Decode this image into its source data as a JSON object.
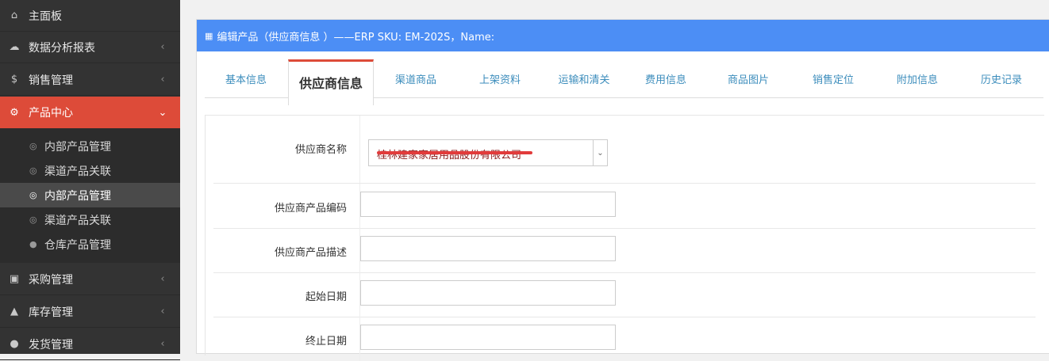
{
  "sidebar": {
    "items": [
      {
        "label": "主面板",
        "icon": "home-icon"
      },
      {
        "label": "数据分析报表",
        "icon": "cloud-icon"
      },
      {
        "label": "销售管理",
        "icon": "dollar-icon"
      },
      {
        "label": "产品中心",
        "icon": "cogs-icon"
      },
      {
        "label": "采购管理",
        "icon": "cube-icon"
      },
      {
        "label": "库存管理",
        "icon": "android-icon"
      },
      {
        "label": "发货管理",
        "icon": "circle-icon"
      }
    ],
    "sub_items": [
      {
        "label": "内部产品管理"
      },
      {
        "label": "渠道产品关联"
      },
      {
        "label": "内部产品管理"
      },
      {
        "label": "渠道产品关联"
      },
      {
        "label": "仓库产品管理"
      }
    ]
  },
  "panel": {
    "title": "编辑产品（供应商信息 ）——ERP SKU: EM-202S，Name:",
    "title_icon": "gift-icon"
  },
  "tabs": [
    {
      "label": "基本信息"
    },
    {
      "label": "供应商信息"
    },
    {
      "label": "渠道商品"
    },
    {
      "label": "上架资料"
    },
    {
      "label": "运输和清关"
    },
    {
      "label": "费用信息"
    },
    {
      "label": "商品图片"
    },
    {
      "label": "销售定位"
    },
    {
      "label": "附加信息"
    },
    {
      "label": "历史记录"
    }
  ],
  "form": {
    "supplier_name_label": "供应商名称",
    "supplier_name_value": "桂林建家家居用品股份有限公司",
    "supplier_code_label": "供应商产品编码",
    "supplier_code_value": "",
    "supplier_desc_label": "供应商产品描述",
    "supplier_desc_value": "",
    "start_date_label": "起始日期",
    "start_date_value": "",
    "end_date_label": "终止日期",
    "end_date_value": ""
  },
  "colors": {
    "sidebar_bg": "#333333",
    "active_red": "#dd4b39",
    "header_blue": "#4c8ef5",
    "tab_link": "#3c8dbc"
  }
}
